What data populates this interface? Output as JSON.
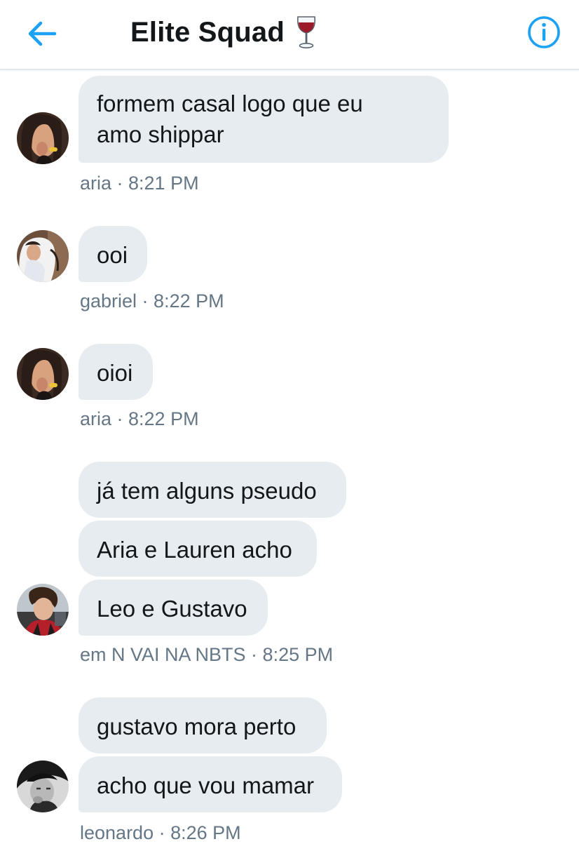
{
  "header": {
    "title": "Elite Squad",
    "back_icon": "arrow-left-icon",
    "info_icon": "info-icon",
    "title_emoji": "wine-glass-icon",
    "accent_color": "#1da1f2"
  },
  "messages": [
    {
      "sender": "aria",
      "time": "8:21 PM",
      "meta": "aria · 8:21 PM",
      "bubbles": [
        "formem casal logo que eu",
        "amo shippar"
      ]
    },
    {
      "sender": "gabriel",
      "time": "8:22 PM",
      "meta": "gabriel · 8:22 PM",
      "bubbles": [
        "ooi"
      ]
    },
    {
      "sender": "aria",
      "time": "8:22 PM",
      "meta": "aria · 8:22 PM",
      "bubbles": [
        "oioi"
      ]
    },
    {
      "sender": "em N VAI NA NBTS",
      "time": "8:25 PM",
      "meta": "em N VAI NA NBTS · 8:25 PM",
      "bubbles": [
        "já tem alguns pseudo",
        "Aria e Lauren acho",
        "Leo e Gustavo"
      ]
    },
    {
      "sender": "leonardo",
      "time": "8:26 PM",
      "meta": "leonardo · 8:26 PM",
      "bubbles": [
        "gustavo mora perto",
        "acho que vou mamar"
      ]
    }
  ],
  "colors": {
    "bubble_bg": "#e6ecf0",
    "meta_text": "#657786",
    "text": "#14171a"
  }
}
